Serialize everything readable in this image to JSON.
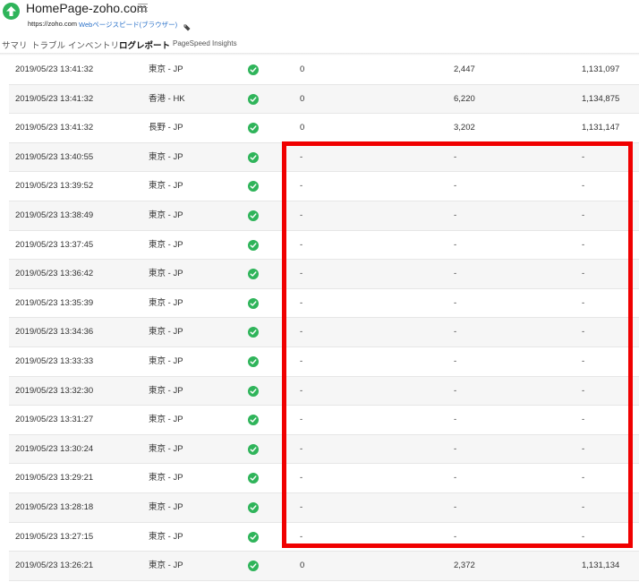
{
  "header": {
    "title": "HomePage-zoho.com",
    "url": "https://zoho.com",
    "monitor_type": "Webページスピード(ブラウザー)",
    "brand_color": "#2fb45a",
    "link_color": "#2a71c9"
  },
  "tabs": [
    {
      "label": "サマリ",
      "active": false
    },
    {
      "label": "トラブル",
      "active": false
    },
    {
      "label": "インベントリ",
      "active": false
    },
    {
      "label": "ログレポート",
      "active": true
    },
    {
      "label": "PageSpeed Insights",
      "active": false
    }
  ],
  "icons": {
    "logo": "up-arrow-icon",
    "menu": "hamburger-menu-icon",
    "tag": "tag-icon",
    "status": "check-circle-icon"
  },
  "rows": [
    {
      "time": "2019/05/23 13:41:32",
      "location": "東京 - JP",
      "status": "up",
      "col4": "0",
      "col5": "2,447",
      "col6": "1,131,097"
    },
    {
      "time": "2019/05/23 13:41:32",
      "location": "香港 - HK",
      "status": "up",
      "col4": "0",
      "col5": "6,220",
      "col6": "1,134,875"
    },
    {
      "time": "2019/05/23 13:41:32",
      "location": "長野 - JP",
      "status": "up",
      "col4": "0",
      "col5": "3,202",
      "col6": "1,131,147"
    },
    {
      "time": "2019/05/23 13:40:55",
      "location": "東京 - JP",
      "status": "up",
      "col4": "-",
      "col5": "-",
      "col6": "-"
    },
    {
      "time": "2019/05/23 13:39:52",
      "location": "東京 - JP",
      "status": "up",
      "col4": "-",
      "col5": "-",
      "col6": "-"
    },
    {
      "time": "2019/05/23 13:38:49",
      "location": "東京 - JP",
      "status": "up",
      "col4": "-",
      "col5": "-",
      "col6": "-"
    },
    {
      "time": "2019/05/23 13:37:45",
      "location": "東京 - JP",
      "status": "up",
      "col4": "-",
      "col5": "-",
      "col6": "-"
    },
    {
      "time": "2019/05/23 13:36:42",
      "location": "東京 - JP",
      "status": "up",
      "col4": "-",
      "col5": "-",
      "col6": "-"
    },
    {
      "time": "2019/05/23 13:35:39",
      "location": "東京 - JP",
      "status": "up",
      "col4": "-",
      "col5": "-",
      "col6": "-"
    },
    {
      "time": "2019/05/23 13:34:36",
      "location": "東京 - JP",
      "status": "up",
      "col4": "-",
      "col5": "-",
      "col6": "-"
    },
    {
      "time": "2019/05/23 13:33:33",
      "location": "東京 - JP",
      "status": "up",
      "col4": "-",
      "col5": "-",
      "col6": "-"
    },
    {
      "time": "2019/05/23 13:32:30",
      "location": "東京 - JP",
      "status": "up",
      "col4": "-",
      "col5": "-",
      "col6": "-"
    },
    {
      "time": "2019/05/23 13:31:27",
      "location": "東京 - JP",
      "status": "up",
      "col4": "-",
      "col5": "-",
      "col6": "-"
    },
    {
      "time": "2019/05/23 13:30:24",
      "location": "東京 - JP",
      "status": "up",
      "col4": "-",
      "col5": "-",
      "col6": "-"
    },
    {
      "time": "2019/05/23 13:29:21",
      "location": "東京 - JP",
      "status": "up",
      "col4": "-",
      "col5": "-",
      "col6": "-"
    },
    {
      "time": "2019/05/23 13:28:18",
      "location": "東京 - JP",
      "status": "up",
      "col4": "-",
      "col5": "-",
      "col6": "-"
    },
    {
      "time": "2019/05/23 13:27:15",
      "location": "東京 - JP",
      "status": "up",
      "col4": "-",
      "col5": "-",
      "col6": "-"
    },
    {
      "time": "2019/05/23 13:26:21",
      "location": "東京 - JP",
      "status": "up",
      "col4": "0",
      "col5": "2,372",
      "col6": "1,131,134"
    }
  ],
  "annotation": {
    "color": "#f00000",
    "first_row": 4,
    "last_row": 17
  }
}
